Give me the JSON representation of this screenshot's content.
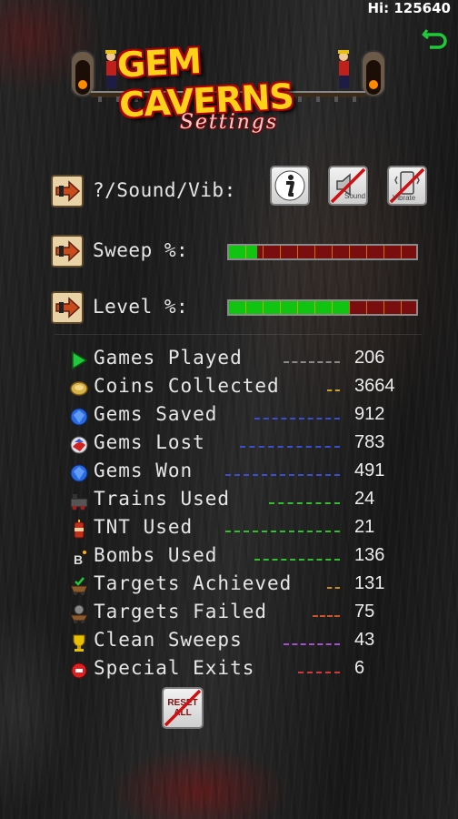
{
  "header": {
    "hi_score": "Hi: 125640",
    "undo_icon": "undo-arrow-icon"
  },
  "logo": {
    "text": "GEM CAVERNS"
  },
  "title": "Settings",
  "rows": {
    "options_label": "?/Sound/Vib:",
    "sweep_label": "Sweep %:",
    "sweep_percent": 15,
    "level_label": "Level %:",
    "level_percent": 64
  },
  "buttons": {
    "info_icon": "info-icon",
    "sound_label": "Sound",
    "vibrate_label": "Vibrate"
  },
  "stats": [
    {
      "label": "Games Played",
      "value": "206",
      "dash_color": "#8a8a8a",
      "icon": "play-icon"
    },
    {
      "label": "Coins Collected",
      "value": "3664",
      "dash_color": "#c9a227",
      "icon": "coin-icon"
    },
    {
      "label": "Gems Saved",
      "value": "912",
      "dash_color": "#3a4fd0",
      "icon": "blue-gem-icon"
    },
    {
      "label": "Gems Lost",
      "value": "783",
      "dash_color": "#3a4fd0",
      "icon": "red-gem-icon"
    },
    {
      "label": "Gems Won",
      "value": "491",
      "dash_color": "#3a4fd0",
      "icon": "blue-gem-icon"
    },
    {
      "label": "Trains Used",
      "value": "24",
      "dash_color": "#2fbf2f",
      "icon": "train-icon"
    },
    {
      "label": "TNT Used",
      "value": "21",
      "dash_color": "#2fbf2f",
      "icon": "tnt-icon"
    },
    {
      "label": "Bombs Used",
      "value": "136",
      "dash_color": "#2fbf2f",
      "icon": "bomb-icon"
    },
    {
      "label": "Targets Achieved",
      "value": "131",
      "dash_color": "#c98a2a",
      "icon": "cart-check-icon"
    },
    {
      "label": "Targets Failed",
      "value": "75",
      "dash_color": "#c9552a",
      "icon": "cart-fail-icon"
    },
    {
      "label": "Clean Sweeps",
      "value": "43",
      "dash_color": "#a64fd0",
      "icon": "trophy-icon"
    },
    {
      "label": "Special Exits",
      "value": "6",
      "dash_color": "#d03a3a",
      "icon": "stop-icon"
    }
  ],
  "reset": {
    "line1": "RESET",
    "line2": "ALL"
  }
}
